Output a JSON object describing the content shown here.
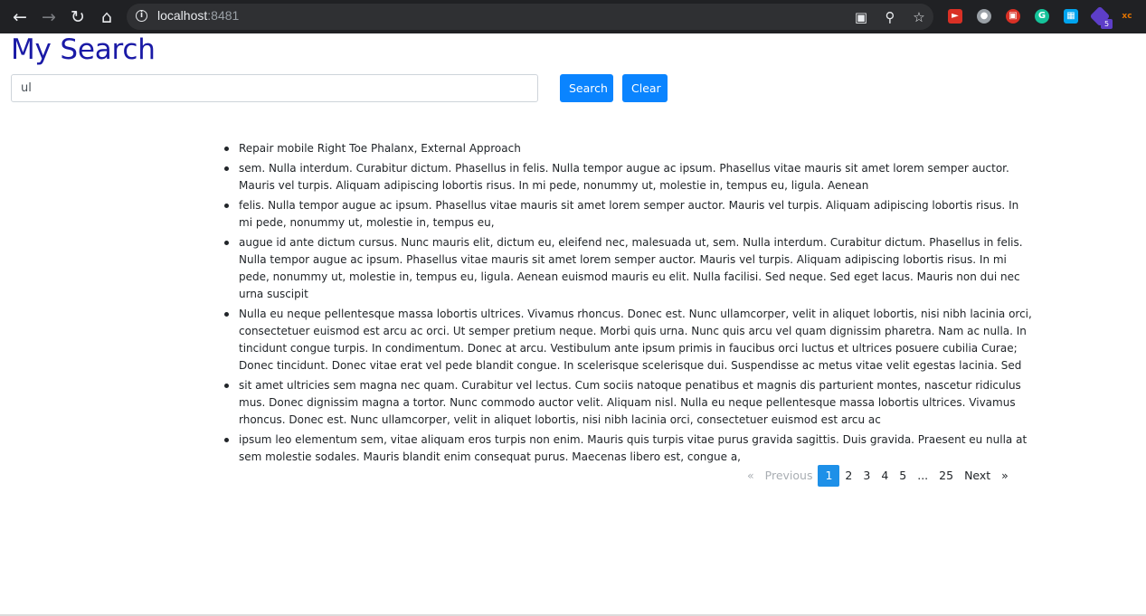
{
  "browser": {
    "url_host": "localhost",
    "url_port": ":8481",
    "extension_badge": "5"
  },
  "page": {
    "title": "My Search",
    "search": {
      "value": "ul",
      "search_label": "Search",
      "clear_label": "Clear"
    },
    "results": [
      "Repair mobile Right Toe Phalanx, External Approach",
      "sem. Nulla interdum. Curabitur dictum. Phasellus in felis. Nulla tempor augue ac ipsum. Phasellus vitae mauris sit amet lorem semper auctor. Mauris vel turpis. Aliquam adipiscing lobortis risus. In mi pede, nonummy ut, molestie in, tempus eu, ligula. Aenean",
      "felis. Nulla tempor augue ac ipsum. Phasellus vitae mauris sit amet lorem semper auctor. Mauris vel turpis. Aliquam adipiscing lobortis risus. In mi pede, nonummy ut, molestie in, tempus eu,",
      "augue id ante dictum cursus. Nunc mauris elit, dictum eu, eleifend nec, malesuada ut, sem. Nulla interdum. Curabitur dictum. Phasellus in felis. Nulla tempor augue ac ipsum. Phasellus vitae mauris sit amet lorem semper auctor. Mauris vel turpis. Aliquam adipiscing lobortis risus. In mi pede, nonummy ut, molestie in, tempus eu, ligula. Aenean euismod mauris eu elit. Nulla facilisi. Sed neque. Sed eget lacus. Mauris non dui nec urna suscipit",
      "Nulla eu neque pellentesque massa lobortis ultrices. Vivamus rhoncus. Donec est. Nunc ullamcorper, velit in aliquet lobortis, nisi nibh lacinia orci, consectetuer euismod est arcu ac orci. Ut semper pretium neque. Morbi quis urna. Nunc quis arcu vel quam dignissim pharetra. Nam ac nulla. In tincidunt congue turpis. In condimentum. Donec at arcu. Vestibulum ante ipsum primis in faucibus orci luctus et ultrices posuere cubilia Curae; Donec tincidunt. Donec vitae erat vel pede blandit congue. In scelerisque scelerisque dui. Suspendisse ac metus vitae velit egestas lacinia. Sed",
      "sit amet ultricies sem magna nec quam. Curabitur vel lectus. Cum sociis natoque penatibus et magnis dis parturient montes, nascetur ridiculus mus. Donec dignissim magna a tortor. Nunc commodo auctor velit. Aliquam nisl. Nulla eu neque pellentesque massa lobortis ultrices. Vivamus rhoncus. Donec est. Nunc ullamcorper, velit in aliquet lobortis, nisi nibh lacinia orci, consectetuer euismod est arcu ac",
      "ipsum leo elementum sem, vitae aliquam eros turpis non enim. Mauris quis turpis vitae purus gravida sagittis. Duis gravida. Praesent eu nulla at sem molestie sodales. Mauris blandit enim consequat purus. Maecenas libero est, congue a,"
    ],
    "pagination": {
      "prev_arrow": "«",
      "prev_label": "Previous",
      "pages": [
        "1",
        "2",
        "3",
        "4",
        "5"
      ],
      "ellipsis": "...",
      "last_page": "25",
      "next_label": "Next",
      "next_arrow": "»",
      "active_page": "1"
    }
  },
  "colors": {
    "title": "#1a1aa6",
    "button": "#0a84ff",
    "active_page": "#1e90e8",
    "chrome_bg": "#202124"
  }
}
